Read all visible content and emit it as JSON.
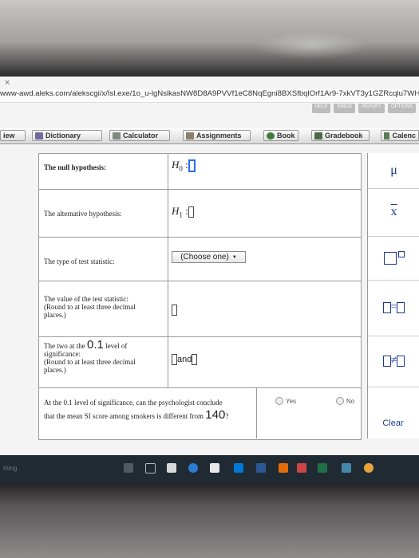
{
  "browser": {
    "close_glyph": "×",
    "url": "www-awd.aleks.com/alekscgi/x/Isl.exe/1o_u-lgNslkasNW8D8A9PVVf1eC8NqEgni8BXSfbqlOrf1Ar9-7xkVT3y1GZRcqlu7WHbxlTOyNR2",
    "top_links": [
      "HELP",
      "INBOX",
      "REPORT",
      "OPTIONS"
    ]
  },
  "toolbar": {
    "items": [
      "iew",
      "Dictionary",
      "Calculator",
      "Assignments",
      "Book",
      "Gradebook",
      "Calenc"
    ],
    "icons": [
      "none",
      "arrow-icon",
      "calculator-icon",
      "pencil-icon",
      "e-book-icon",
      "gradebook-icon",
      "calendar-icon"
    ]
  },
  "question": {
    "null_label": "The null hypothesis:",
    "null_symbol": "H",
    "null_sub": "0",
    "alt_label": "The alternative hypothesis:",
    "alt_symbol": "H",
    "alt_sub": "1",
    "colon": ":",
    "stat_label": "The type of test statistic:",
    "stat_select": "(Choose one)",
    "stat_arrow": "▼",
    "value_label_1": "The value of the test statistic:",
    "value_label_2": "(Round to at least three decimal",
    "value_label_3": "places.)",
    "crit_label_1a": "The two at the",
    "crit_level": "0.1",
    "crit_label_1b": "level of",
    "crit_label_2": "significance:",
    "crit_label_3": "(Round to at least three decimal",
    "crit_label_4": "places.)",
    "crit_and": "and",
    "concl_1": "At the 0.1 level of significance, can the psychologist conclude",
    "concl_2": "that the mean SI score among smokers is different from",
    "concl_value": "140",
    "concl_q": "?",
    "yes": "Yes",
    "no": "No"
  },
  "symbols": {
    "mu": "μ",
    "xbar": "x",
    "clear": "Clear"
  },
  "taskbar": {
    "hint": "thing"
  }
}
